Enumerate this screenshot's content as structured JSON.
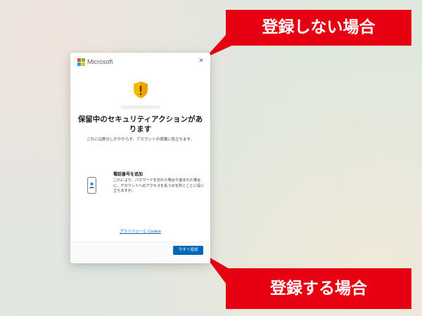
{
  "dialog": {
    "brand": "Microsoft",
    "close_label": "✕",
    "heading": "保留中のセキュリティアクションがあります",
    "subtext": "これには数分しかかからず、アカウントの保護に役立ちます。",
    "method": {
      "title": "電話番号を追加",
      "description": "これにより、パスワードを忘れた場合や盗まれた場合に、アカウントへのアクセスを失うのを防ぐことに役に立ちますが。"
    },
    "privacy_link": "プライバシーと Cookie",
    "add_button": "今すぐ追加"
  },
  "callouts": {
    "top": "登録しない場合",
    "bottom": "登録する場合"
  },
  "colors": {
    "callout_red": "#e60012",
    "button_blue": "#0067b8",
    "shield_yellow": "#f5b800",
    "ms_red": "#f25022",
    "ms_green": "#7fba00",
    "ms_blue": "#00a4ef",
    "ms_yellow": "#ffb900"
  },
  "icons": {
    "logo": "microsoft-logo-icon",
    "close": "close-icon",
    "shield": "shield-warning-icon",
    "phone": "phone-icon"
  }
}
